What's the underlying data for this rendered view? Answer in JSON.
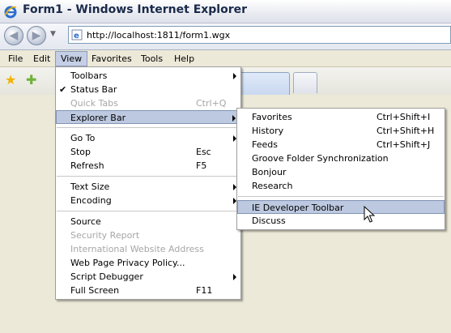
{
  "window": {
    "title": "Form1 - Windows Internet Explorer"
  },
  "address": {
    "url": "http://localhost:1811/form1.wgx"
  },
  "menubar": [
    "File",
    "Edit",
    "View",
    "Favorites",
    "Tools",
    "Help"
  ],
  "view_menu": [
    {
      "label": "Toolbars",
      "submenu": true
    },
    {
      "label": "Status Bar",
      "checked": true
    },
    {
      "label": "Quick Tabs",
      "shortcut": "Ctrl+Q",
      "disabled": true
    },
    {
      "label": "Explorer Bar",
      "submenu": true,
      "highlighted": true
    },
    {
      "separator": true
    },
    {
      "label": "Go To",
      "submenu": true
    },
    {
      "label": "Stop",
      "shortcut": "Esc"
    },
    {
      "label": "Refresh",
      "shortcut": "F5"
    },
    {
      "separator": true
    },
    {
      "label": "Text Size",
      "submenu": true
    },
    {
      "label": "Encoding",
      "submenu": true
    },
    {
      "separator": true
    },
    {
      "label": "Source"
    },
    {
      "label": "Security Report",
      "disabled": true
    },
    {
      "label": "International Website Address",
      "disabled": true
    },
    {
      "label": "Web Page Privacy Policy..."
    },
    {
      "label": "Script Debugger",
      "submenu": true
    },
    {
      "label": "Full Screen",
      "shortcut": "F11"
    }
  ],
  "explorer_bar_menu": [
    {
      "label": "Favorites",
      "shortcut": "Ctrl+Shift+I"
    },
    {
      "label": "History",
      "shortcut": "Ctrl+Shift+H"
    },
    {
      "label": "Feeds",
      "shortcut": "Ctrl+Shift+J"
    },
    {
      "label": "Groove Folder Synchronization"
    },
    {
      "label": "Bonjour"
    },
    {
      "label": "Research"
    },
    {
      "separator": true
    },
    {
      "label": "IE Developer Toolbar",
      "highlighted": true
    },
    {
      "label": "Discuss"
    }
  ],
  "colors": {
    "menu_highlight": "#bdc9e0",
    "chrome": "#ece9d8"
  }
}
